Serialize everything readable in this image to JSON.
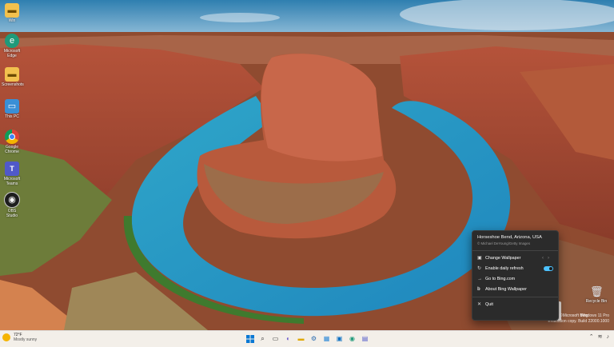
{
  "desktop": {
    "icons": [
      {
        "label": "Win",
        "icon": "folder-icon"
      },
      {
        "label": "Microsoft Edge",
        "icon": "edge-icon"
      },
      {
        "label": "Screenshots",
        "icon": "folder-icon"
      },
      {
        "label": "This PC",
        "icon": "pc-icon"
      },
      {
        "label": "Google Chrome",
        "icon": "chrome-icon"
      },
      {
        "label": "Microsoft Teams",
        "icon": "teams-icon"
      },
      {
        "label": "OBS Studio",
        "icon": "obs-icon"
      }
    ],
    "recycle_bin": {
      "label": "Recycle Bin",
      "icon": "recycle-bin-icon"
    }
  },
  "bing_menu": {
    "title": "Horseshoe Bend, Arizona, USA",
    "credit": "© Michael DeYoung/Getty Images",
    "items": [
      {
        "label": "Change Wallpaper",
        "icon": "image-icon"
      },
      {
        "label": "Enable daily refresh",
        "icon": "refresh-icon",
        "toggle_on": true
      },
      {
        "label": "Go to Bing.com",
        "icon": "arrow-icon"
      },
      {
        "label": "About Bing Wallpaper",
        "icon": "bing-icon"
      },
      {
        "label": "Quit",
        "icon": "close-icon"
      }
    ]
  },
  "watermark": {
    "line1": "Windows 11 Pro",
    "line2": "Evaluation copy. Build 22000.1000",
    "copyright": "©Microsoft Bing"
  },
  "taskbar": {
    "weather": {
      "temp": "72°F",
      "desc": "Mostly sunny"
    },
    "apps": [
      "start-icon",
      "search-icon",
      "task-view-icon",
      "chat-icon",
      "file-explorer-icon",
      "settings-icon",
      "widgets-icon",
      "store-icon",
      "edge-icon",
      "teams-icon"
    ]
  },
  "colors": {
    "accent": "#4cc2ff",
    "menu_bg": "#2b2b2b",
    "taskbar_bg": "#f3efe9"
  }
}
